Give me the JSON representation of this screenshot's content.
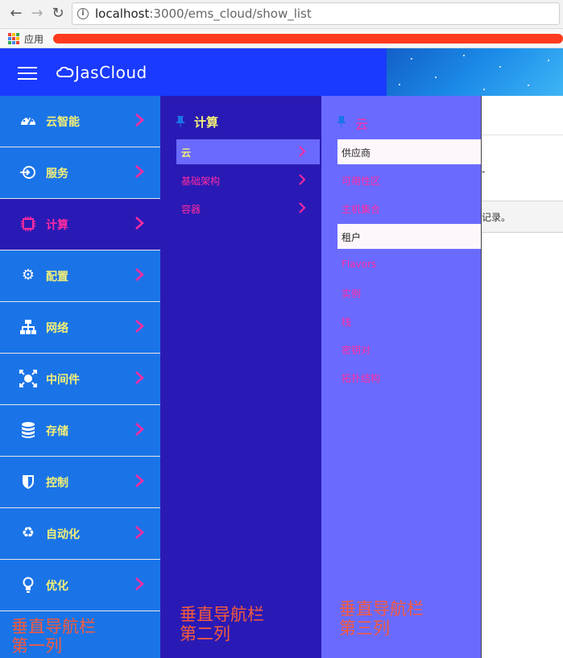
{
  "browser": {
    "url_host": "localhost",
    "url_path": ":3000/ems_cloud/show_list",
    "bookmark_apps_label": "应用"
  },
  "header": {
    "logo_text": "JasCloud"
  },
  "column1": {
    "items": [
      {
        "label": "云智能",
        "icon": "dashboard-icon"
      },
      {
        "label": "服务",
        "icon": "services-icon"
      },
      {
        "label": "计算",
        "icon": "chip-icon",
        "active": true
      },
      {
        "label": "配置",
        "icon": "gear-icon"
      },
      {
        "label": "网络",
        "icon": "network-icon"
      },
      {
        "label": "中间件",
        "icon": "middleware-icon"
      },
      {
        "label": "存储",
        "icon": "database-icon"
      },
      {
        "label": "控制",
        "icon": "shield-icon"
      },
      {
        "label": "自动化",
        "icon": "recycle-icon"
      },
      {
        "label": "优化",
        "icon": "lightbulb-icon"
      }
    ],
    "note_line1": "垂直导航栏",
    "note_line2": "第一列"
  },
  "column2": {
    "title": "计算",
    "items": [
      {
        "label": "云",
        "active": true
      },
      {
        "label": "基础架构"
      },
      {
        "label": "容器"
      }
    ],
    "note_line1": "垂直导航栏",
    "note_line2": "第二列"
  },
  "column3": {
    "title": "云",
    "items": [
      {
        "label": "供应商",
        "active": true
      },
      {
        "label": "可用性区"
      },
      {
        "label": "主机集合"
      },
      {
        "label": "租户",
        "active": true
      },
      {
        "label": "Flavors"
      },
      {
        "label": "实例"
      },
      {
        "label": "栈"
      },
      {
        "label": "密钥对"
      },
      {
        "label": "拓扑结构"
      }
    ],
    "note_line1": "垂直导航栏",
    "note_line2": "第三列"
  },
  "page": {
    "partial_text": "记录。",
    "partial_dot": "-"
  },
  "colors": {
    "header_blue": "#1a3aff",
    "col1_blue": "#1a74e8",
    "col2_indigo": "#2a1ab5",
    "col3_periwinkle": "#6a6aff",
    "accent_pink": "#ff2aa0",
    "label_yellow": "#f4f077",
    "note_red": "#f55a3c"
  }
}
